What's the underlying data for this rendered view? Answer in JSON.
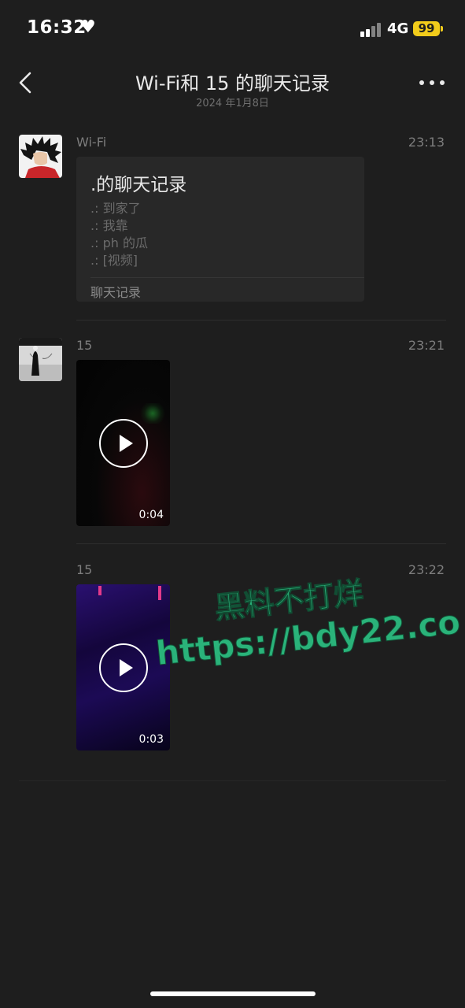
{
  "status_bar": {
    "time": "16:32",
    "network": "4G",
    "battery": "99",
    "battery_color": "#f2cc1b"
  },
  "nav": {
    "title": "Wi-Fi和 15 的聊天记录",
    "subtitle": "2024 年1月8日"
  },
  "messages": [
    {
      "sender": "Wi-Fi",
      "time": "23:13",
      "record": {
        "title": ".的聊天记录",
        "lines": [
          ".: 到家了",
          ".: 我靠",
          ".: ph 的瓜",
          ".: [视频]"
        ],
        "footer": "聊天记录"
      }
    },
    {
      "sender": "15",
      "time": "23:21",
      "video_duration": "0:04"
    },
    {
      "sender": "15",
      "time": "23:22",
      "video_duration": "0:03"
    }
  ],
  "watermark": {
    "line1": "黑料不打烊",
    "line2": "https://bdy22.co",
    "color": "#2ab37a"
  }
}
